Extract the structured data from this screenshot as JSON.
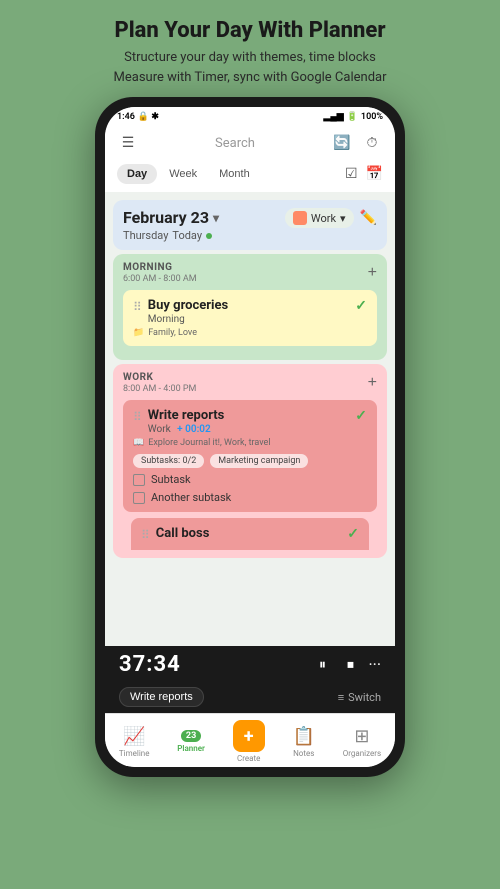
{
  "header": {
    "title": "Plan Your Day With Planner",
    "subtitle": "Structure your day with themes, time blocks\nMeasure with Timer, sync with Google Calendar"
  },
  "statusBar": {
    "time": "1:46",
    "battery": "100%"
  },
  "topNav": {
    "searchPlaceholder": "Search"
  },
  "viewTabs": {
    "tabs": [
      "Day",
      "Week",
      "Month"
    ],
    "active": "Day"
  },
  "dateHeader": {
    "date": "February 23",
    "dayOfWeek": "Thursday",
    "todayLabel": "Today",
    "workLabel": "Work"
  },
  "morningBlock": {
    "title": "MORNING",
    "time": "6:00 AM - 8:00 AM",
    "tasks": [
      {
        "name": "Buy groceries",
        "sub": "Morning",
        "tags": "Family, Love",
        "done": true
      }
    ]
  },
  "workBlock": {
    "title": "WORK",
    "time": "8:00 AM - 4:00 PM",
    "tasks": [
      {
        "name": "Write reports",
        "sub": "Work",
        "timer": "+ 00:02",
        "tags": "Explore Journal it!, Work, travel",
        "subtaskLabel": "Subtasks: 0/2",
        "campaignLabel": "Marketing campaign",
        "subtasks": [
          "Subtask",
          "Another subtask"
        ],
        "done": true
      }
    ],
    "partialTask": {
      "name": "Call boss"
    }
  },
  "timerBar": {
    "time": "37:34",
    "taskLabel": "Write reports",
    "switchLabel": "Switch"
  },
  "bottomNav": {
    "items": [
      {
        "label": "Timeline",
        "icon": "📈",
        "active": false
      },
      {
        "label": "Planner",
        "badge": "23",
        "active": true
      },
      {
        "label": "Create",
        "isCreate": true
      },
      {
        "label": "Notes",
        "icon": "📋",
        "active": false
      },
      {
        "label": "Organizers",
        "icon": "⊞",
        "active": false
      }
    ]
  }
}
